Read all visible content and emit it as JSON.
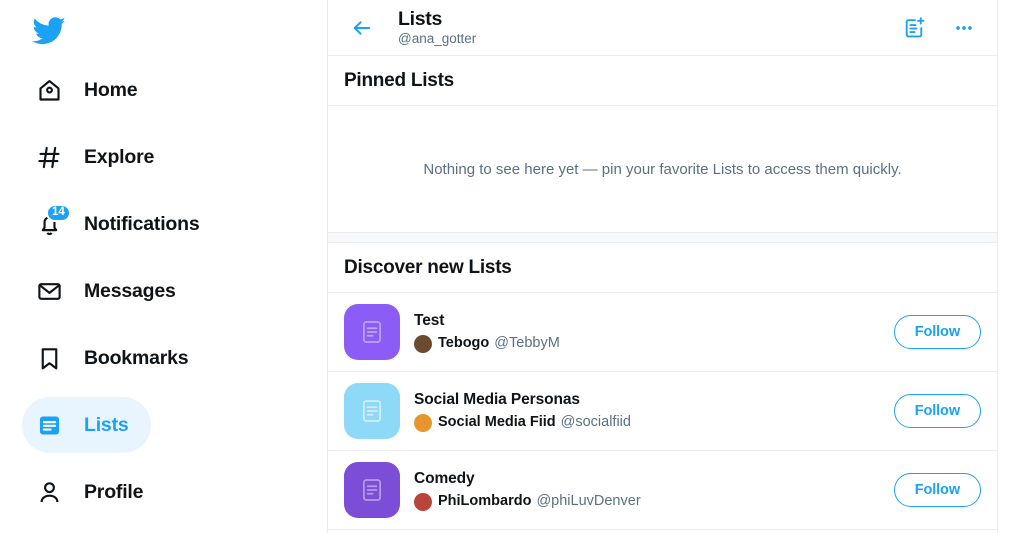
{
  "colors": {
    "accent": "#1DA1F2",
    "active_pill_bg": "#E8F5FE",
    "text_primary": "#0F1419",
    "text_secondary": "#5B7083",
    "border": "#EBEEF0",
    "thumb_purple": "#8B5CF6",
    "thumb_light_blue": "#8ED8F8"
  },
  "sidebar": {
    "logo_icon": "twitter-bird-icon",
    "items": [
      {
        "label": "Home",
        "icon": "home-icon",
        "active": false,
        "badge": ""
      },
      {
        "label": "Explore",
        "icon": "hashtag-icon",
        "active": false,
        "badge": ""
      },
      {
        "label": "Notifications",
        "icon": "bell-icon",
        "active": false,
        "badge": "14"
      },
      {
        "label": "Messages",
        "icon": "envelope-icon",
        "active": false,
        "badge": ""
      },
      {
        "label": "Bookmarks",
        "icon": "bookmark-icon",
        "active": false,
        "badge": ""
      },
      {
        "label": "Lists",
        "icon": "list-icon",
        "active": true,
        "badge": ""
      },
      {
        "label": "Profile",
        "icon": "person-icon",
        "active": false,
        "badge": ""
      }
    ]
  },
  "header": {
    "back_icon": "back-arrow-icon",
    "title": "Lists",
    "subtitle": "@ana_gotter",
    "actions": [
      {
        "icon": "create-list-icon"
      },
      {
        "icon": "more-options-icon"
      }
    ]
  },
  "pinned_section": {
    "title": "Pinned Lists",
    "empty_message": "Nothing to see here yet — pin your favorite Lists to access them quickly."
  },
  "discover_section": {
    "title": "Discover new Lists",
    "follow_label": "Follow",
    "lists": [
      {
        "name": "Test",
        "owner_name": "Tebogo",
        "owner_handle": "@TebbyM",
        "thumb_color": "#8B5CF6",
        "avatar_color": "#6B4A2F",
        "follow_label": "Follow"
      },
      {
        "name": "Social Media Personas",
        "owner_name": "Social Media Fiid",
        "owner_handle": "@socialfiid",
        "thumb_color": "#8ED8F8",
        "avatar_color": "#E8952E",
        "follow_label": "Follow"
      },
      {
        "name": "Comedy",
        "owner_name": "PhiLombardo",
        "owner_handle": "@phiLuvDenver",
        "thumb_color": "#7C4DD6",
        "avatar_color": "#B9453A",
        "follow_label": "Follow"
      }
    ]
  }
}
